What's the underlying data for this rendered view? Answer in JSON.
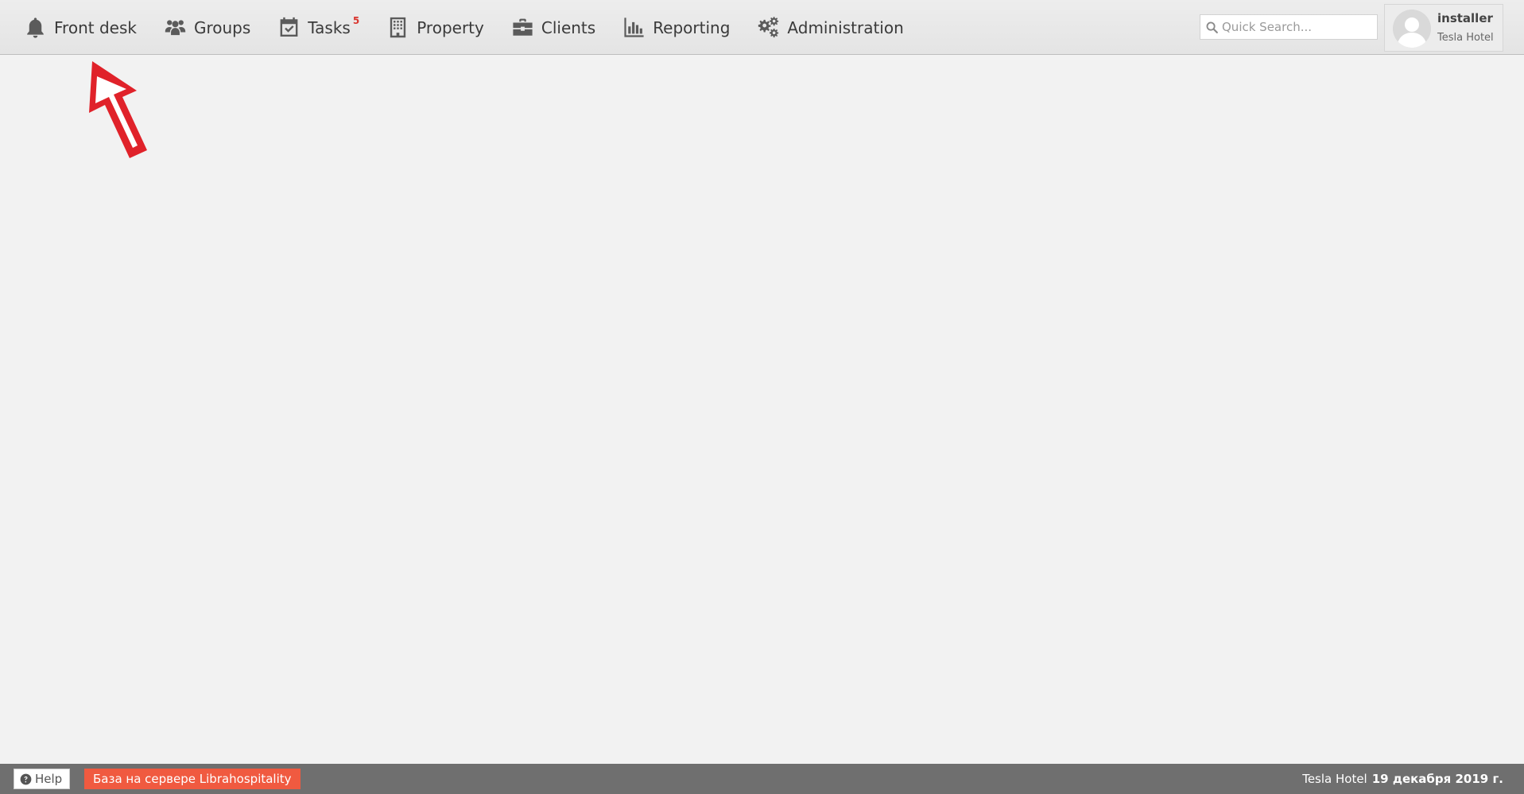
{
  "nav": {
    "items": [
      {
        "label": "Front desk",
        "icon": "bell-icon"
      },
      {
        "label": "Groups",
        "icon": "users-icon"
      },
      {
        "label": "Tasks",
        "icon": "calendar-check-icon",
        "badge": "5"
      },
      {
        "label": "Property",
        "icon": "building-icon"
      },
      {
        "label": "Clients",
        "icon": "briefcase-icon"
      },
      {
        "label": "Reporting",
        "icon": "bar-chart-icon"
      },
      {
        "label": "Administration",
        "icon": "gears-icon"
      }
    ]
  },
  "search": {
    "placeholder": "Quick Search..."
  },
  "user": {
    "name": "installer",
    "hotel": "Tesla Hotel"
  },
  "footer": {
    "help_label": "Help",
    "server_label": "База на сервере Librahospitality",
    "hotel_name": "Tesla Hotel",
    "date": "19 декабря 2019 г."
  },
  "colors": {
    "badge": "#d9352e",
    "server_badge": "#f05a40",
    "arrow": "#e0222a",
    "footer_bg": "#6f6f6f"
  }
}
